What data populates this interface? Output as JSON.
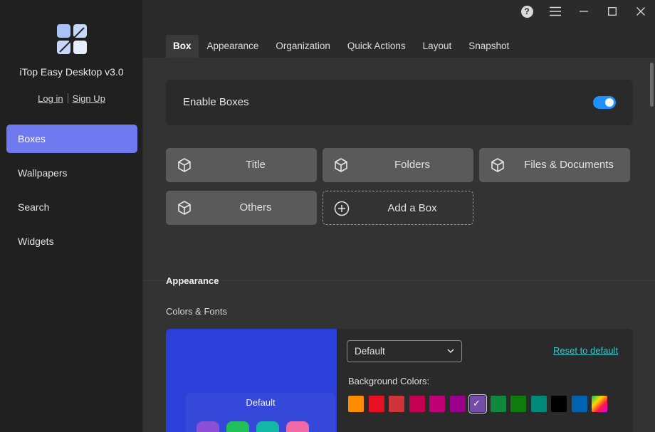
{
  "app": {
    "title": "iTop Easy Desktop v3.0"
  },
  "auth": {
    "login": "Log in",
    "signup": "Sign Up"
  },
  "sidebar": {
    "items": [
      {
        "label": "Boxes",
        "active": true
      },
      {
        "label": "Wallpapers",
        "active": false
      },
      {
        "label": "Search",
        "active": false
      },
      {
        "label": "Widgets",
        "active": false
      }
    ]
  },
  "titlebar": {
    "help": "?"
  },
  "tabs": [
    {
      "label": "Box",
      "active": true
    },
    {
      "label": "Appearance",
      "active": false
    },
    {
      "label": "Organization",
      "active": false
    },
    {
      "label": "Quick Actions",
      "active": false
    },
    {
      "label": "Layout",
      "active": false
    },
    {
      "label": "Snapshot",
      "active": false
    }
  ],
  "enable": {
    "label": "Enable Boxes",
    "on": true
  },
  "boxes": [
    {
      "label": "Title",
      "icon": "cube-icon"
    },
    {
      "label": "Folders",
      "icon": "cube-icon"
    },
    {
      "label": "Files & Documents",
      "icon": "cube-icon"
    },
    {
      "label": "Others",
      "icon": "cube-icon"
    },
    {
      "label": "Add a Box",
      "icon": "plus-circle-icon"
    }
  ],
  "appearance": {
    "section_title": "Appearance",
    "sub_title": "Colors & Fonts",
    "preview_label": "Default",
    "select_value": "Default",
    "reset_label": "Reset to default",
    "bg_colors_label": "Background Colors:",
    "swatches": [
      "#ff8c00",
      "#e81123",
      "#d13438",
      "#c30052",
      "#bf0077",
      "#9a0089",
      "#744da9",
      "#10893e",
      "#107c10",
      "#00897b",
      "#000000",
      "#0063b1",
      "gradient"
    ],
    "selected_swatch": 6,
    "accent": "#6f79f0",
    "preview_bg": "#2b3fd9"
  }
}
